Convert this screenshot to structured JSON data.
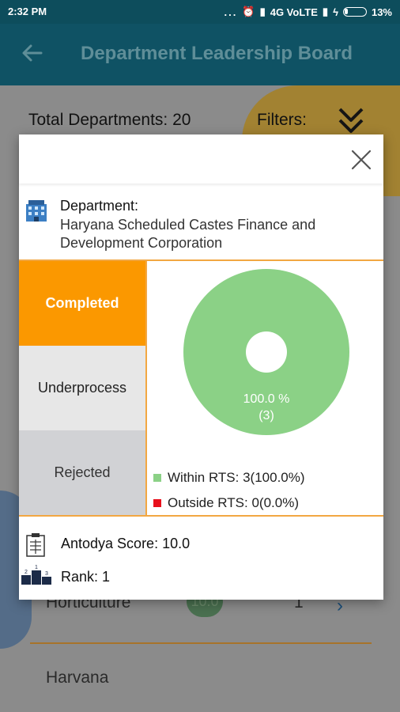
{
  "status_bar": {
    "time": "2:32 PM",
    "dots": "...",
    "network": "4G VoLTE",
    "battery": "13%"
  },
  "header": {
    "title": "Department Leadership Board"
  },
  "background": {
    "total_departments": "Total Departments: 20",
    "filters_label": "Filters:",
    "row1_name": "Horticulture",
    "row1_score": "10.0",
    "row1_rank": "1",
    "row2_name": "Harvana"
  },
  "dialog": {
    "department_label": "Department:",
    "department_name": "Haryana Scheduled Castes Finance and Development Corporation",
    "tabs": [
      {
        "label": "Completed",
        "selected": true
      },
      {
        "label": "Underprocess",
        "selected": false
      },
      {
        "label": "Rejected",
        "selected": false
      }
    ],
    "pie": {
      "percent_label": "100.0 %",
      "count_label": "(3)",
      "within_value": 3,
      "outside_value": 0,
      "within_color": "#8bd186",
      "outside_color": "#e8101c"
    },
    "legend": {
      "within": "Within RTS: 3(100.0%)",
      "outside": "Outside RTS: 0(0.0%)"
    },
    "antodya_score": "Antodya Score: 10.0",
    "rank": "Rank: 1"
  },
  "colors": {
    "accent": "#fb9800",
    "header": "#0f5264",
    "divider": "#f2a742"
  }
}
